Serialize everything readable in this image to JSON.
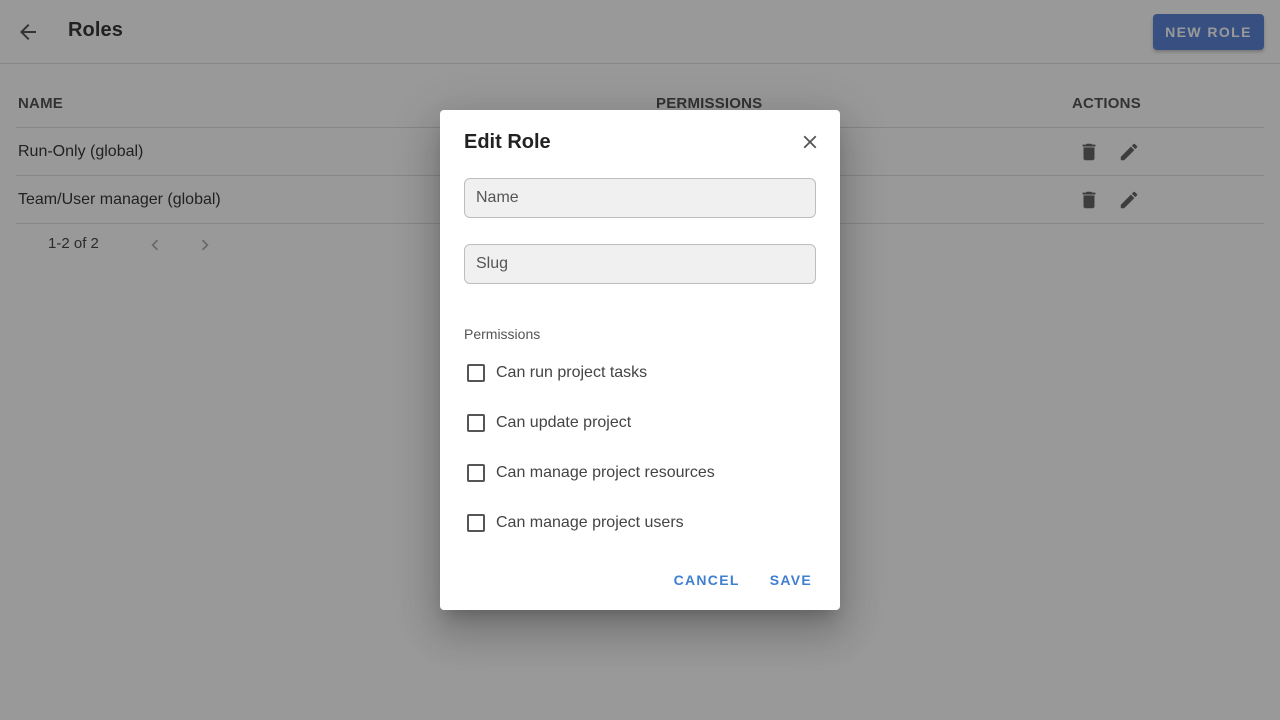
{
  "header": {
    "title": "Roles",
    "new_role_label": "NEW ROLE"
  },
  "table": {
    "columns": [
      "NAME",
      "PERMISSIONS",
      "ACTIONS"
    ],
    "rows": [
      {
        "name": "Run-Only (global)"
      },
      {
        "name": "Team/User manager (global)"
      }
    ],
    "pagination": "1-2 of 2"
  },
  "dialog": {
    "title": "Edit Role",
    "name_placeholder": "Name",
    "slug_placeholder": "Slug",
    "permissions_heading": "Permissions",
    "permissions": [
      {
        "label": "Can run project tasks",
        "checked": false
      },
      {
        "label": "Can update project",
        "checked": false
      },
      {
        "label": "Can manage project resources",
        "checked": false
      },
      {
        "label": "Can manage project users",
        "checked": false
      }
    ],
    "cancel_label": "CANCEL",
    "save_label": "SAVE"
  },
  "colors": {
    "primary": "#4d79d2",
    "dialog_action": "#3f7fd1",
    "overlay": "#212121"
  },
  "icons": {
    "back": "arrow-left-icon",
    "delete": "trash-icon",
    "edit": "pencil-icon",
    "close": "close-icon",
    "prev": "chevron-left-icon",
    "next": "chevron-right-icon"
  }
}
